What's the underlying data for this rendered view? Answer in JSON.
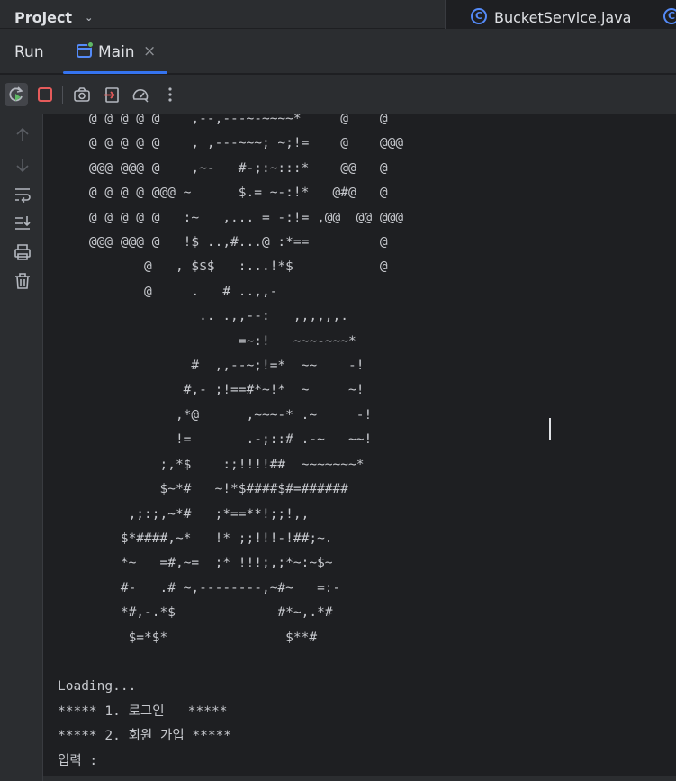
{
  "topbar": {
    "project_label": "Project",
    "editor_tab_label": "BucketService.java"
  },
  "runbar": {
    "run_label": "Run",
    "tab_label": "Main"
  },
  "toolbar": {
    "icons": [
      "rerun-icon",
      "stop-icon",
      "camera-icon",
      "exit-icon",
      "gauge-icon",
      "more-icon"
    ]
  },
  "sidebar": {
    "icons": [
      "arrow-up-icon",
      "arrow-down-icon",
      "soft-wrap-icon",
      "scroll-to-end-icon",
      "print-icon",
      "trash-icon"
    ]
  },
  "colors": {
    "accent": "#3574f0",
    "stop": "#e55b5b",
    "run_green": "#5fb865"
  },
  "console": {
    "lines": [
      "    @ @ @ @ @    ,--,---~-~~~~*     @    @",
      "    @ @ @ @ @    , ,---~~~; ~;!=    @    @@@",
      "    @@@ @@@ @    ,~-   #-;:~:::*    @@   @",
      "    @ @ @ @ @@@ ~      $.= ~-:!*   @#@   @",
      "    @ @ @ @ @   :~   ,... = -:!= ,@@  @@ @@@",
      "    @@@ @@@ @   !$ ..,#...@ :*==         @",
      "           @   , $$$   :...!*$           @",
      "           @     .   # ..,,-",
      "                  .. .,,--:   ,,,,,,.",
      "                       =~:!   ~~~-~~~*",
      "                 #  ,,--~;!=*  ~~    -!",
      "                #,- ;!==#*~!*  ~     ~!",
      "               ,*@      ,~~~-* .~     -!",
      "               !=       .-;::# .-~   ~~!",
      "             ;,*$    :;!!!!##  ~~~~~~~*",
      "             $~*#   ~!*$####$#=######",
      "         ,;:;,~*#   ;*==**!;;!,,",
      "        $*####,~*   !* ;;!!!-!##;~.",
      "        *~   =#,~=  ;* !!!;,;*~:~$~",
      "        #-   .# ~,--------,~#~   =:-",
      "        *#,-.*$             #*~,.*#",
      "         $=*$*               $**#",
      "",
      "Loading...",
      "***** 1. 로그인   *****",
      "***** 2. 회원 가입 *****",
      "입력 :"
    ]
  }
}
